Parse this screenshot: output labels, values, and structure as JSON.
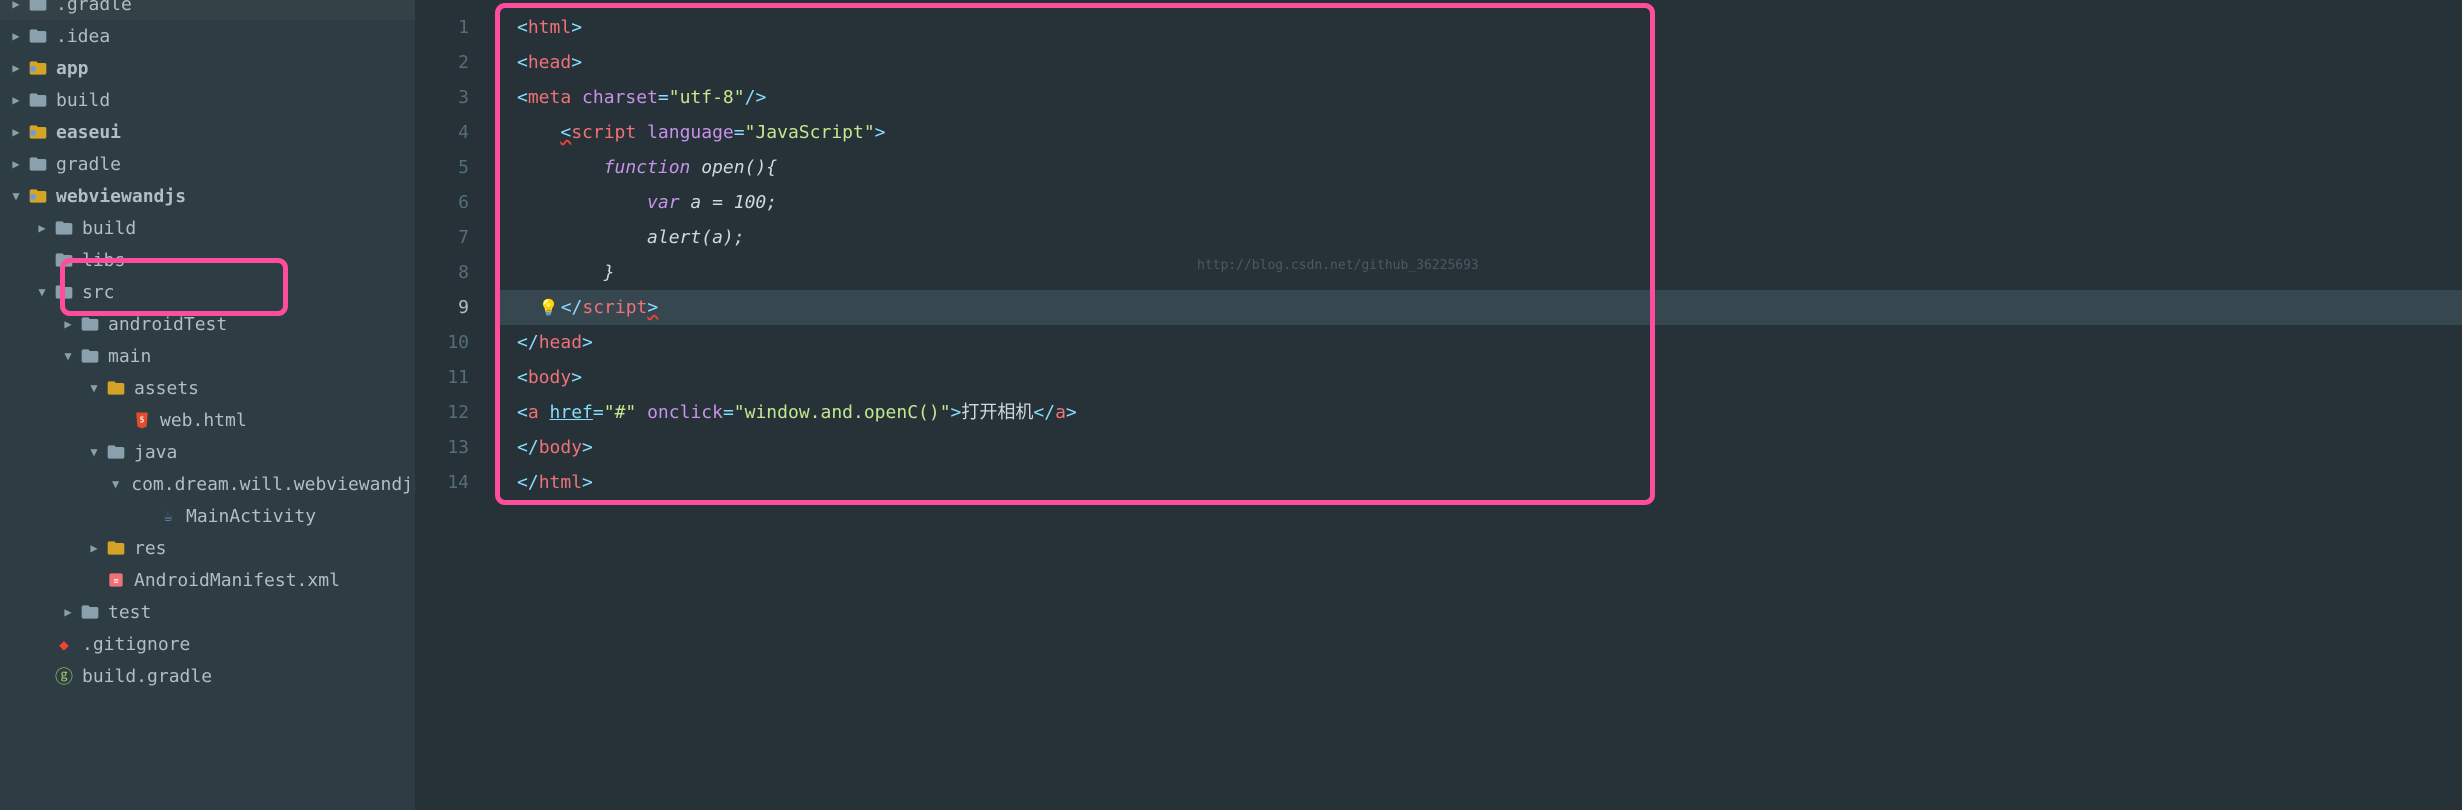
{
  "tree": {
    "items": [
      {
        "arrow": "▶",
        "indent": 0,
        "icon": "folder",
        "color": "gray",
        "label": ".gradle",
        "cut": true
      },
      {
        "arrow": "▶",
        "indent": 0,
        "icon": "folder",
        "color": "gray",
        "label": ".idea"
      },
      {
        "arrow": "▶",
        "indent": 0,
        "icon": "module",
        "color": "gold",
        "label": "app",
        "bold": true
      },
      {
        "arrow": "▶",
        "indent": 0,
        "icon": "folder",
        "color": "gray",
        "label": "build"
      },
      {
        "arrow": "▶",
        "indent": 0,
        "icon": "module",
        "color": "gold",
        "label": "easeui",
        "bold": true
      },
      {
        "arrow": "▶",
        "indent": 0,
        "icon": "folder",
        "color": "gray",
        "label": "gradle"
      },
      {
        "arrow": "▼",
        "indent": 0,
        "icon": "module",
        "color": "gold",
        "label": "webviewandjs",
        "bold": true
      },
      {
        "arrow": "▶",
        "indent": 1,
        "icon": "folder",
        "color": "gray",
        "label": "build"
      },
      {
        "arrow": "",
        "indent": 1,
        "icon": "folder",
        "color": "gray",
        "label": "libs"
      },
      {
        "arrow": "▼",
        "indent": 1,
        "icon": "folder",
        "color": "gray",
        "label": "src"
      },
      {
        "arrow": "▶",
        "indent": 2,
        "icon": "folder",
        "color": "gray",
        "label": "androidTest"
      },
      {
        "arrow": "▼",
        "indent": 2,
        "icon": "folder",
        "color": "gray",
        "label": "main"
      },
      {
        "arrow": "▼",
        "indent": 3,
        "icon": "resfolder",
        "color": "gold",
        "label": "assets"
      },
      {
        "arrow": "",
        "indent": 4,
        "icon": "html",
        "color": "orange",
        "label": "web.html"
      },
      {
        "arrow": "▼",
        "indent": 3,
        "icon": "folder",
        "color": "gray",
        "label": "java"
      },
      {
        "arrow": "▼",
        "indent": 4,
        "icon": "package",
        "color": "gold",
        "label": "com.dream.will.webviewandjs"
      },
      {
        "arrow": "",
        "indent": 5,
        "icon": "java",
        "color": "blue",
        "label": "MainActivity"
      },
      {
        "arrow": "▶",
        "indent": 3,
        "icon": "resfolder",
        "color": "gold",
        "label": "res"
      },
      {
        "arrow": "",
        "indent": 3,
        "icon": "xml",
        "color": "green",
        "label": "AndroidManifest.xml"
      },
      {
        "arrow": "▶",
        "indent": 2,
        "icon": "folder",
        "color": "gray",
        "label": "test"
      },
      {
        "arrow": "",
        "indent": 1,
        "icon": "git",
        "color": "green",
        "label": ".gitignore"
      },
      {
        "arrow": "",
        "indent": 1,
        "icon": "gradle",
        "color": "green",
        "label": "build.gradle"
      }
    ]
  },
  "line_numbers": [
    "1",
    "2",
    "3",
    "4",
    "5",
    "6",
    "7",
    "8",
    "9",
    "10",
    "11",
    "12",
    "13",
    "14"
  ],
  "current_line": 9,
  "code": {
    "l1": {
      "tag": "html"
    },
    "l2": {
      "tag": "head"
    },
    "l3": {
      "tag": "meta",
      "attr": "charset",
      "val": "\"utf-8\""
    },
    "l4": {
      "tag": "script",
      "attr": "language",
      "val": "\"JavaScript\""
    },
    "l5": {
      "kw": "function",
      "name": "open",
      "rest": "(){",
      "text_pre": ""
    },
    "l6": {
      "kw": "var",
      "body": " a = 100;"
    },
    "l7": {
      "name": "alert",
      "body": "(a);"
    },
    "l8": {
      "body": "}"
    },
    "l9": {
      "tag": "script"
    },
    "l10": {
      "tag": "head"
    },
    "l11": {
      "tag": "body"
    },
    "l12": {
      "tag": "a",
      "href_attr": "href",
      "href_val": "\"#\"",
      "onclick_attr": "onclick",
      "onclick_val": "\"window.and.openC()\"",
      "text": "打开相机"
    },
    "l13": {
      "tag": "body"
    },
    "l14": {
      "tag": "html"
    }
  },
  "watermark": "http://blog.csdn.net/github_36225693"
}
